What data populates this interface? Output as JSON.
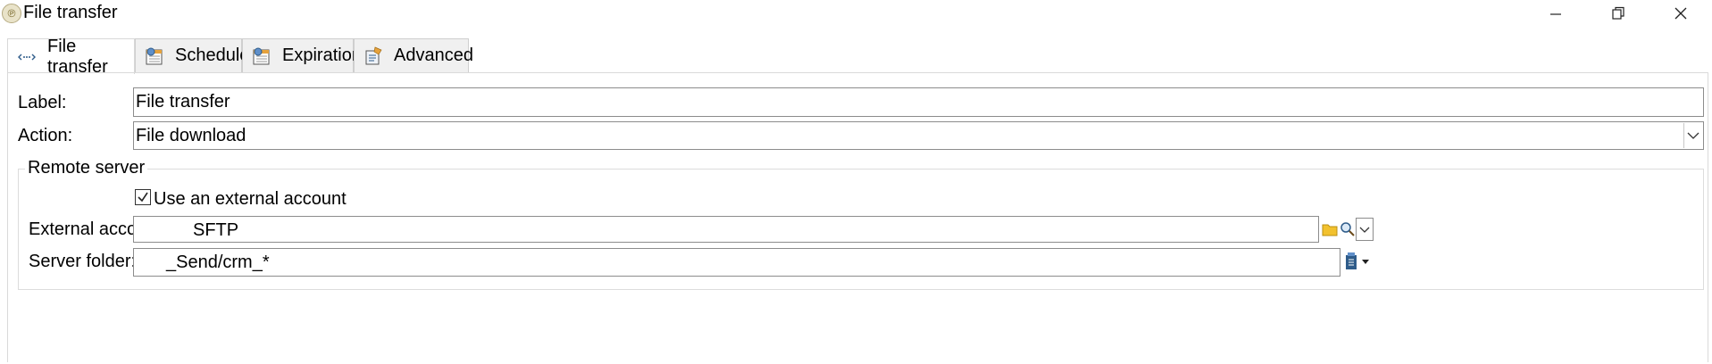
{
  "window": {
    "title": "File transfer",
    "app_icon_glyph": "℗"
  },
  "tabs": [
    {
      "label": "File transfer",
      "icon": "transfer-arrows-icon",
      "active": true
    },
    {
      "label": "Schedule",
      "icon": "calendar-clock-icon",
      "active": false
    },
    {
      "label": "Expiration",
      "icon": "calendar-clock-icon",
      "active": false
    },
    {
      "label": "Advanced",
      "icon": "advanced-settings-icon",
      "active": false
    }
  ],
  "form": {
    "label_caption": "Label:",
    "label_value": "File transfer",
    "action_caption": "Action:",
    "action_value": "File download",
    "remote_server": {
      "group_title": "Remote server",
      "use_external_label": "Use an external account",
      "use_external_checked": true,
      "external_account_caption": "External account:",
      "external_account_value": "SFTP",
      "server_folder_caption": "Server folder:",
      "server_folder_value": "_Send/crm_*"
    }
  },
  "colors": {
    "folder_icon": "#f2c12e",
    "accent_icon": "#2f5c8a"
  }
}
